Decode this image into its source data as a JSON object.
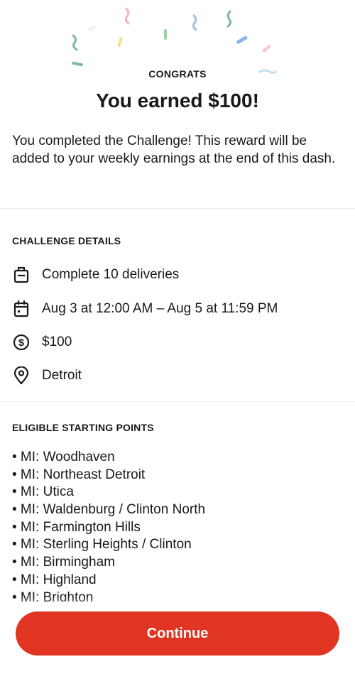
{
  "header": {
    "eyebrow": "CONGRATS",
    "title": "You earned $100!",
    "body": "You completed the Challenge! This reward will be added to your weekly earnings at the end of this dash."
  },
  "details": {
    "title": "CHALLENGE DETAILS",
    "items": [
      {
        "icon": "delivery-bag-icon",
        "text": "Complete 10 deliveries"
      },
      {
        "icon": "calendar-icon",
        "text": "Aug 3 at 12:00 AM – Aug 5 at 11:59 PM"
      },
      {
        "icon": "dollar-circle-icon",
        "text": "$100"
      },
      {
        "icon": "location-pin-icon",
        "text": "Detroit"
      }
    ]
  },
  "starting_points": {
    "title": "ELIGIBLE STARTING POINTS",
    "items": [
      "• MI: Woodhaven",
      "• MI: Northeast Detroit",
      "• MI: Utica",
      "• MI: Waldenburg / Clinton North",
      "• MI: Farmington Hills",
      "• MI: Sterling Heights / Clinton",
      "• MI: Birmingham",
      "• MI: Highland",
      "• MI: Brighton"
    ]
  },
  "cta": {
    "label": "Continue"
  },
  "colors": {
    "accent": "#e03522",
    "text": "#191919",
    "divider": "#ececec"
  }
}
